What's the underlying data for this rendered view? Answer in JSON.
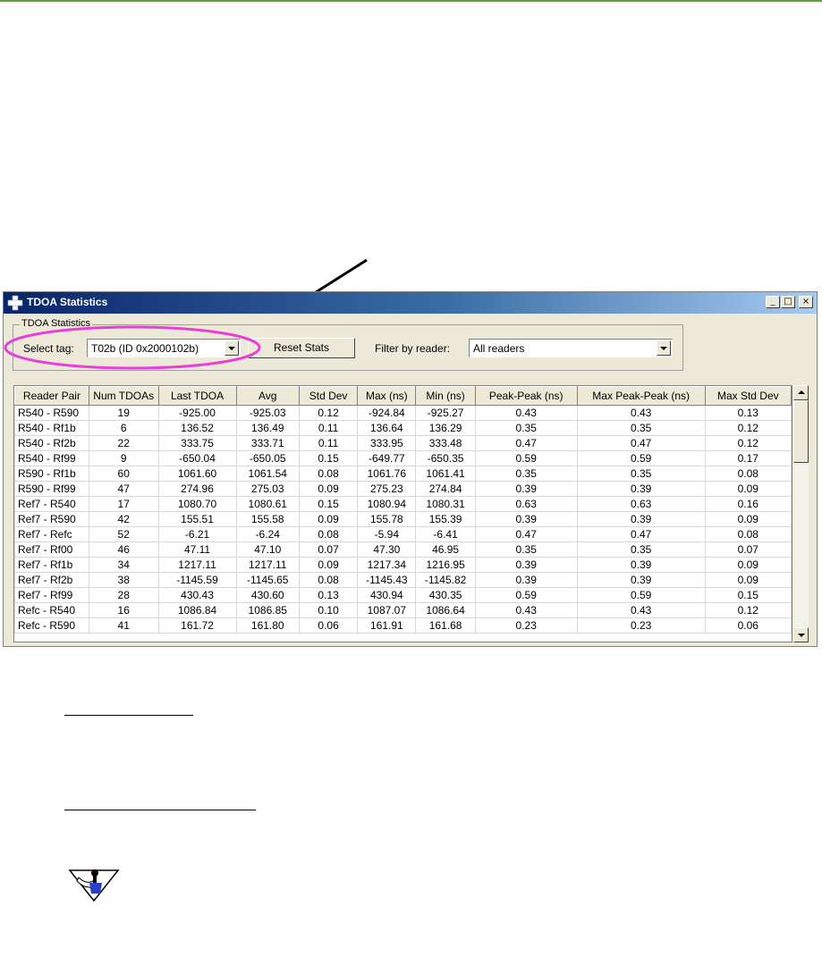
{
  "window": {
    "title": "TDOA Statistics",
    "minimize_label": "_",
    "maximize_label": "□",
    "close_label": "×"
  },
  "controls": {
    "group_label": "TDOA Statistics",
    "select_tag_label": "Select tag:",
    "select_tag_value": "T02b (ID 0x2000102b)",
    "reset_button": "Reset Stats",
    "filter_label": "Filter by reader:",
    "filter_value": "All readers"
  },
  "table": {
    "columns": [
      "Reader Pair",
      "Num TDOAs",
      "Last TDOA",
      "Avg",
      "Std Dev",
      "Max (ns)",
      "Min (ns)",
      "Peak-Peak (ns)",
      "Max Peak-Peak (ns)",
      "Max Std Dev"
    ],
    "rows": [
      [
        "R540 - R590",
        "19",
        "-925.00",
        "-925.03",
        "0.12",
        "-924.84",
        "-925.27",
        "0.43",
        "0.43",
        "0.13"
      ],
      [
        "R540 - Rf1b",
        "6",
        "136.52",
        "136.49",
        "0.11",
        "136.64",
        "136.29",
        "0.35",
        "0.35",
        "0.12"
      ],
      [
        "R540 - Rf2b",
        "22",
        "333.75",
        "333.71",
        "0.11",
        "333.95",
        "333.48",
        "0.47",
        "0.47",
        "0.12"
      ],
      [
        "R540 - Rf99",
        "9",
        "-650.04",
        "-650.05",
        "0.15",
        "-649.77",
        "-650.35",
        "0.59",
        "0.59",
        "0.17"
      ],
      [
        "R590 - Rf1b",
        "60",
        "1061.60",
        "1061.54",
        "0.08",
        "1061.76",
        "1061.41",
        "0.35",
        "0.35",
        "0.08"
      ],
      [
        "R590 - Rf99",
        "47",
        "274.96",
        "275.03",
        "0.09",
        "275.23",
        "274.84",
        "0.39",
        "0.39",
        "0.09"
      ],
      [
        "Ref7 - R540",
        "17",
        "1080.70",
        "1080.61",
        "0.15",
        "1080.94",
        "1080.31",
        "0.63",
        "0.63",
        "0.16"
      ],
      [
        "Ref7 - R590",
        "42",
        "155.51",
        "155.58",
        "0.09",
        "155.78",
        "155.39",
        "0.39",
        "0.39",
        "0.09"
      ],
      [
        "Ref7 - Refc",
        "52",
        "-6.21",
        "-6.24",
        "0.08",
        "-5.94",
        "-6.41",
        "0.47",
        "0.47",
        "0.08"
      ],
      [
        "Ref7 - Rf00",
        "46",
        "47.11",
        "47.10",
        "0.07",
        "47.30",
        "46.95",
        "0.35",
        "0.35",
        "0.07"
      ],
      [
        "Ref7 - Rf1b",
        "34",
        "1217.11",
        "1217.11",
        "0.09",
        "1217.34",
        "1216.95",
        "0.39",
        "0.39",
        "0.09"
      ],
      [
        "Ref7 - Rf2b",
        "38",
        "-1145.59",
        "-1145.65",
        "0.08",
        "-1145.43",
        "-1145.82",
        "0.39",
        "0.39",
        "0.09"
      ],
      [
        "Ref7 - Rf99",
        "28",
        "430.43",
        "430.60",
        "0.13",
        "430.94",
        "430.35",
        "0.59",
        "0.59",
        "0.15"
      ],
      [
        "Refc - R540",
        "16",
        "1086.84",
        "1086.85",
        "0.10",
        "1087.07",
        "1086.64",
        "0.43",
        "0.43",
        "0.12"
      ],
      [
        "Refc - R590",
        "41",
        "161.72",
        "161.80",
        "0.06",
        "161.91",
        "161.68",
        "0.23",
        "0.23",
        "0.06"
      ]
    ]
  },
  "colors": {
    "doc_rule": "#5fa33a",
    "title_bar": "#0a246a",
    "highlight": "#e83fd8"
  },
  "icons": [
    "app-cross-icon",
    "callout-arrow",
    "note-hand-icon"
  ]
}
